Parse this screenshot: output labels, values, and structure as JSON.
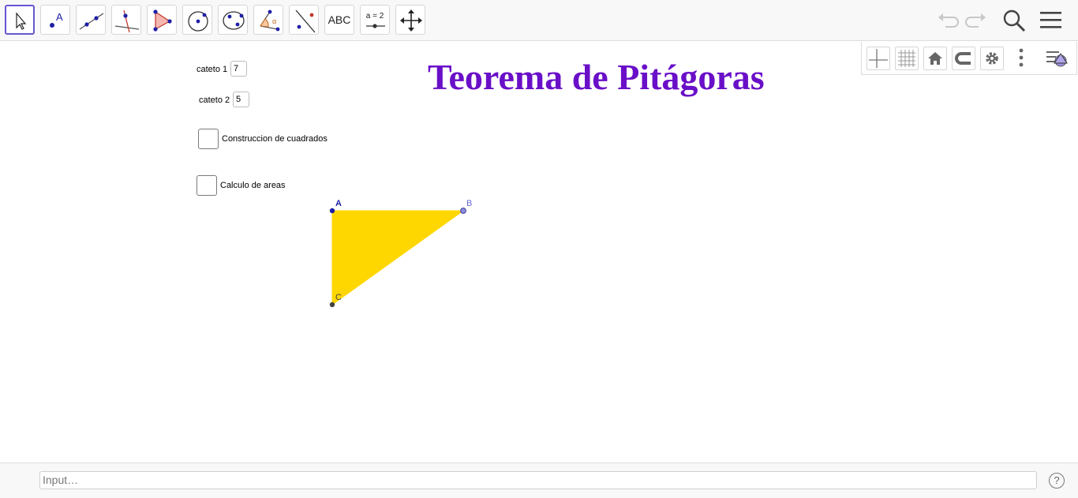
{
  "toolbar": {
    "tools": [
      {
        "name": "move"
      },
      {
        "name": "point",
        "glyph": "A"
      },
      {
        "name": "line"
      },
      {
        "name": "perpendicular-line"
      },
      {
        "name": "polygon"
      },
      {
        "name": "circle-center-point"
      },
      {
        "name": "conic-through-points"
      },
      {
        "name": "angle",
        "glyph": "α"
      },
      {
        "name": "reflect"
      },
      {
        "name": "text",
        "label": "ABC"
      },
      {
        "name": "slider",
        "label": "a = 2"
      },
      {
        "name": "move-graphics-view"
      }
    ]
  },
  "title": "Teorema de Pitágoras",
  "controls": {
    "cateto1": {
      "label": "cateto 1",
      "value": "7"
    },
    "cateto2": {
      "label": "cateto 2",
      "value": "5"
    },
    "checkbox_squares": {
      "label": "Construccion de cuadrados",
      "checked": false
    },
    "checkbox_areas": {
      "label": "Calculo de areas",
      "checked": false
    }
  },
  "figure": {
    "points": [
      {
        "label": "A",
        "color": "#1f1fa6"
      },
      {
        "label": "B",
        "color": "#6a6ad0"
      },
      {
        "label": "C",
        "color": "#444444"
      }
    ],
    "fill_color": "#ffd700"
  },
  "input_bar": {
    "placeholder": "Input…"
  },
  "colors": {
    "title": "#6a0fc8",
    "active_tool": "#6557d2"
  }
}
